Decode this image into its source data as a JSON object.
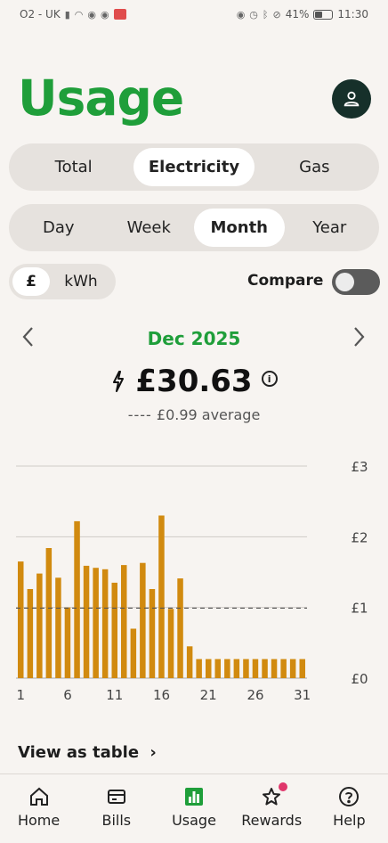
{
  "status_bar": {
    "carrier": "O2 - UK",
    "battery": "41%",
    "time": "11:30"
  },
  "page": {
    "title": "Usage"
  },
  "fuel_tabs": [
    {
      "label": "Total",
      "active": false
    },
    {
      "label": "Electricity",
      "active": true
    },
    {
      "label": "Gas",
      "active": false
    }
  ],
  "period_tabs": [
    {
      "label": "Day",
      "active": false
    },
    {
      "label": "Week",
      "active": false
    },
    {
      "label": "Month",
      "active": true
    },
    {
      "label": "Year",
      "active": false
    }
  ],
  "units": {
    "pound": "£",
    "kwh": "kWh",
    "selected": "£"
  },
  "compare": {
    "label": "Compare",
    "enabled": false
  },
  "period_nav": {
    "label": "Dec 2025",
    "prev_icon": "chevron-left-icon",
    "next_icon": "chevron-right-icon"
  },
  "summary": {
    "amount": "£30.63",
    "average": "£0.99 average"
  },
  "chart_data": {
    "type": "bar",
    "x": [
      1,
      2,
      3,
      4,
      5,
      6,
      7,
      8,
      9,
      10,
      11,
      12,
      13,
      14,
      15,
      16,
      17,
      18,
      19,
      20,
      21,
      22,
      23,
      24,
      25,
      26,
      27,
      28,
      29,
      30,
      31
    ],
    "values": [
      1.65,
      1.26,
      1.48,
      1.84,
      1.42,
      1.0,
      2.22,
      1.59,
      1.56,
      1.54,
      1.35,
      1.6,
      0.7,
      1.63,
      1.26,
      2.3,
      0.98,
      1.41,
      0.45,
      0.27,
      0.27,
      0.27,
      0.27,
      0.27,
      0.27,
      0.27,
      0.27,
      0.27,
      0.27,
      0.27,
      0.27
    ],
    "x_tick_labels": [
      "1",
      "6",
      "11",
      "16",
      "21",
      "26",
      "31"
    ],
    "y_tick_labels": [
      "£0",
      "£1",
      "£2",
      "£3"
    ],
    "ylim": [
      0,
      3
    ],
    "average": 0.99,
    "bar_color": "#d18a0f"
  },
  "links": {
    "view_table": "View as table"
  },
  "bottom_nav": [
    {
      "label": "Home",
      "icon": "home-icon",
      "active": false
    },
    {
      "label": "Bills",
      "icon": "bills-icon",
      "active": false
    },
    {
      "label": "Usage",
      "icon": "usage-chart-icon",
      "active": true
    },
    {
      "label": "Rewards",
      "icon": "star-icon",
      "active": false
    },
    {
      "label": "Help",
      "icon": "help-icon",
      "active": false
    }
  ],
  "colors": {
    "accent_green": "#1f9e3a",
    "bar": "#d18a0f",
    "dark": "#16302a"
  }
}
